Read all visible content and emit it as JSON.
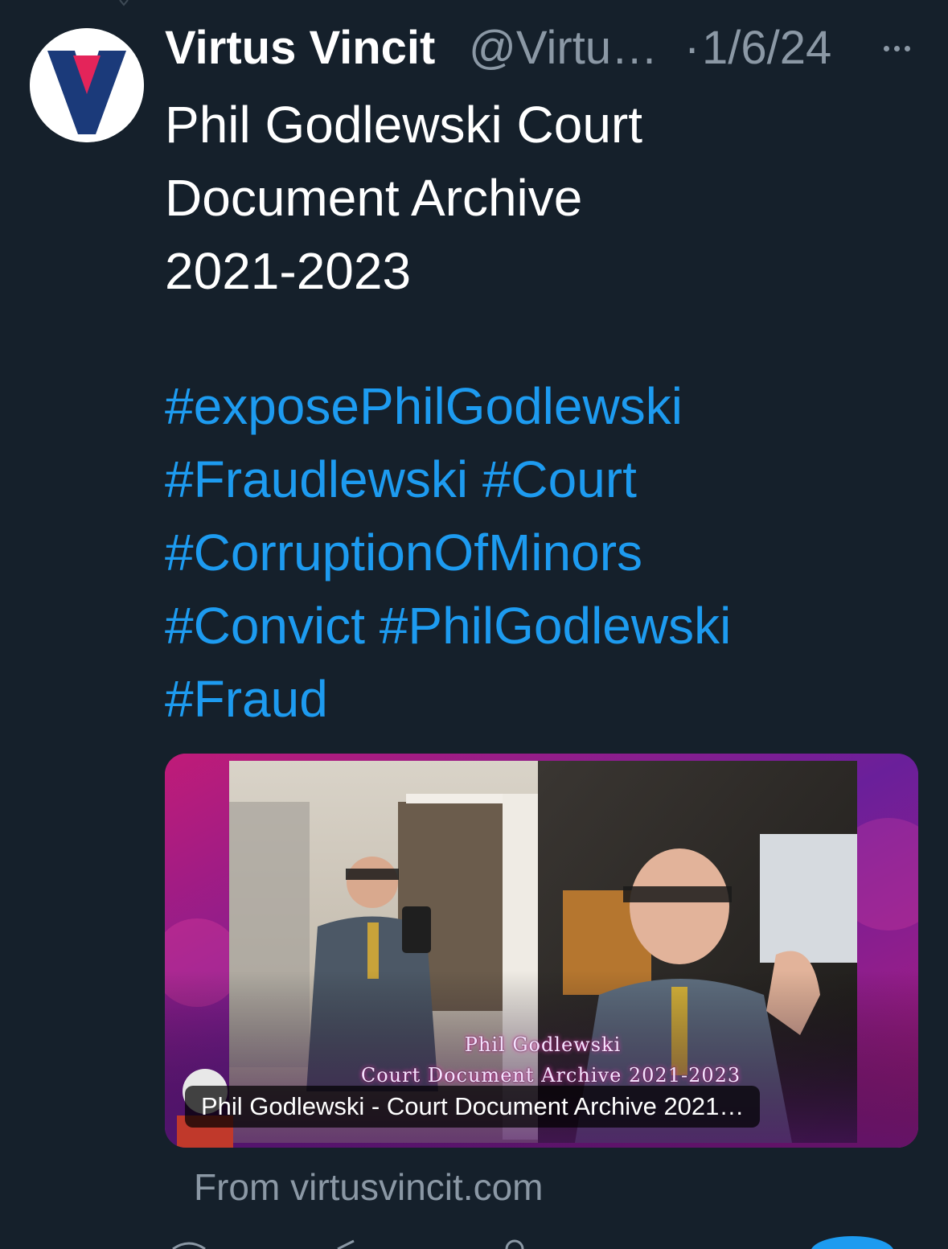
{
  "tweet": {
    "author": {
      "display_name": "Virtus Vincit",
      "handle": "@Virtu…",
      "avatar": "virtus-vincit-logo"
    },
    "separator": "·",
    "date": "1/6/24",
    "more_icon": "more-horizontal-icon",
    "text_lines": [
      "Phil Godlewski Court",
      "Document Archive",
      "2021-2023"
    ],
    "hashtag_lines": [
      [
        "#exposePhilGodlewski"
      ],
      [
        "#Fraudlewski",
        "#Court"
      ],
      [
        "#CorruptionOfMinors"
      ],
      [
        "#Convict",
        "#PhilGodlewski"
      ],
      [
        "#Fraud"
      ]
    ],
    "card": {
      "caption_line1": "Phil Godlewski",
      "caption_line2": "Court Document Archive 2021-2023",
      "title": "Phil Godlewski - Court Document Archive 2021…"
    },
    "source": "From virtusvincit.com"
  },
  "colors": {
    "background": "#15202b",
    "text": "#ffffff",
    "secondary_text": "#8b98a5",
    "link": "#1d9bf0",
    "logo_navy": "#1b3a7a",
    "logo_red": "#e4245a"
  }
}
